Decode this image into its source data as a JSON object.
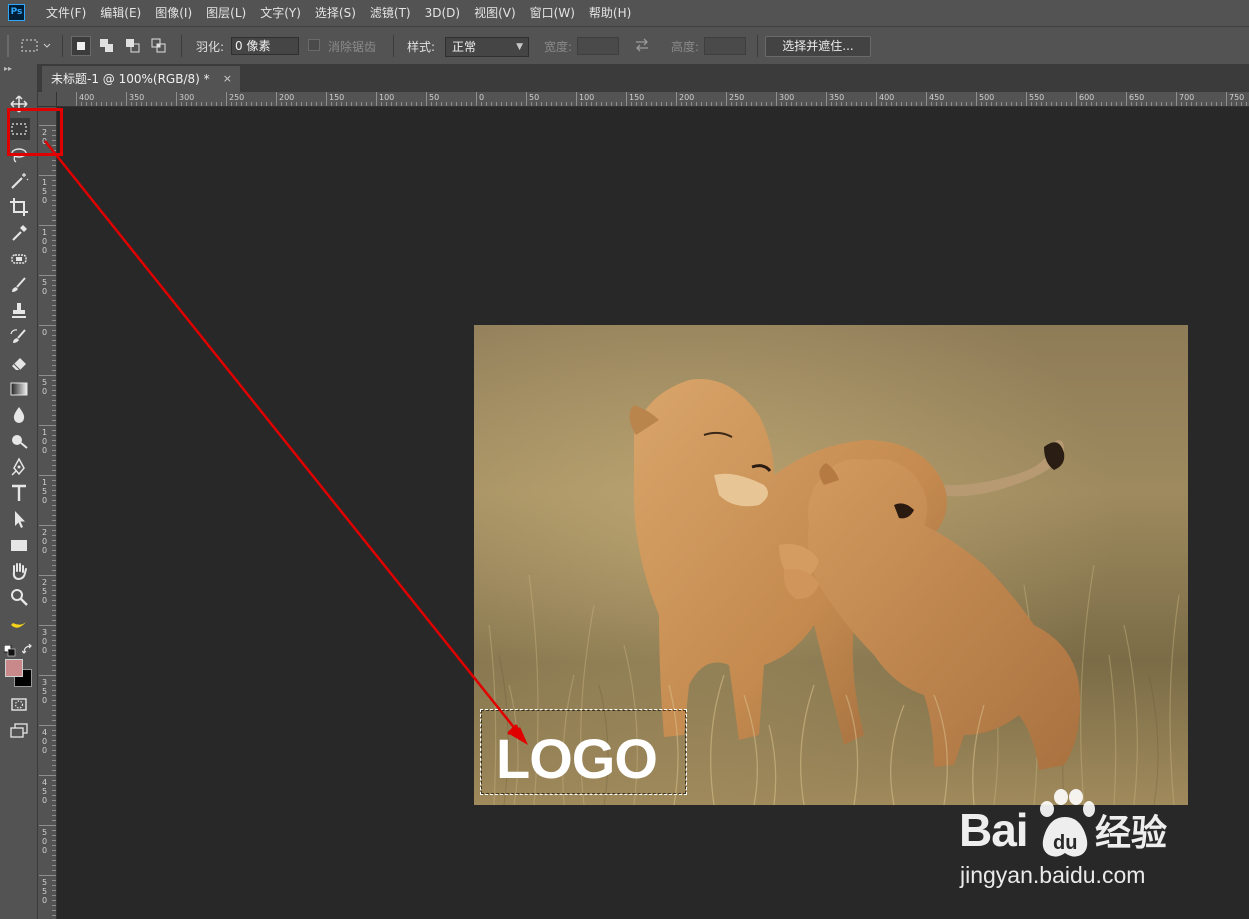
{
  "app": {
    "logo_text": "Ps"
  },
  "menu": [
    "文件(F)",
    "编辑(E)",
    "图像(I)",
    "图层(L)",
    "文字(Y)",
    "选择(S)",
    "滤镜(T)",
    "3D(D)",
    "视图(V)",
    "窗口(W)",
    "帮助(H)"
  ],
  "options": {
    "feather_label": "羽化:",
    "feather_value": "0 像素",
    "antialias_label": "消除锯齿",
    "style_label": "样式:",
    "style_value": "正常",
    "width_label": "宽度:",
    "height_label": "高度:",
    "select_mask_label": "选择并遮住..."
  },
  "document": {
    "tab_title": "未标题-1 @ 100%(RGB/8) *",
    "close_glyph": "×"
  },
  "ruler_h_labels": [
    "400",
    "350",
    "300",
    "250",
    "200",
    "150",
    "100",
    "50",
    "0",
    "50",
    "100",
    "150",
    "200",
    "250",
    "300",
    "350",
    "400",
    "450",
    "500",
    "550",
    "600",
    "650",
    "700",
    "750"
  ],
  "ruler_v_labels": [
    "2\n0",
    "1\n5\n0",
    "1\n0\n0",
    "5\n0",
    "0",
    "5\n0",
    "1\n0\n0",
    "1\n5\n0",
    "2\n0\n0",
    "2\n5\n0",
    "3\n0\n0",
    "3\n5\n0",
    "4\n0\n0",
    "4\n5\n0",
    "5\n0\n0",
    "5\n5\n0"
  ],
  "tools": [
    "move-tool",
    "rect-marquee-tool",
    "lasso-tool",
    "magic-wand-tool",
    "crop-tool",
    "eyedropper-tool",
    "patch-tool",
    "brush-tool",
    "clone-stamp-tool",
    "history-brush-tool",
    "eraser-tool",
    "gradient-tool",
    "blur-tool",
    "dodge-tool",
    "pen-tool",
    "type-tool",
    "path-select-tool",
    "rectangle-tool",
    "hand-tool",
    "zoom-tool",
    "banana-tool"
  ],
  "canvas": {
    "logo_text": "LOGO"
  },
  "colors": {
    "foreground": "#c9898b",
    "background": "#000000",
    "annotation": "#e00000"
  },
  "watermark": {
    "brand": "Bai",
    "brand_cn": "经验",
    "url": "jingyan.baidu.com"
  }
}
